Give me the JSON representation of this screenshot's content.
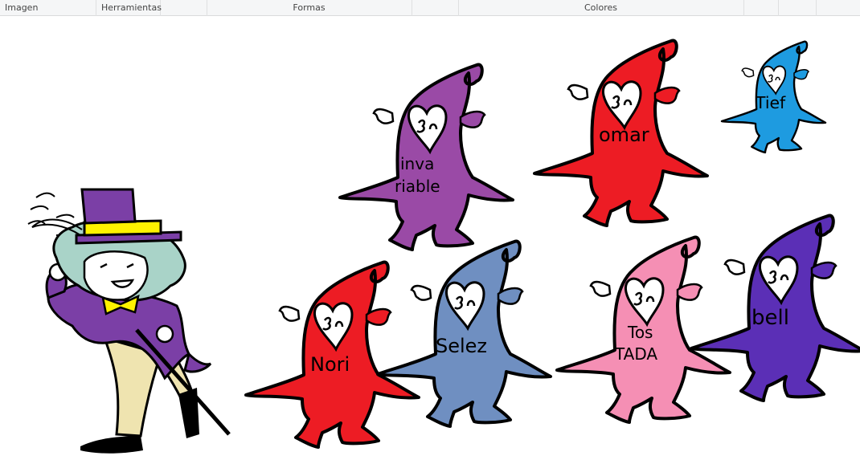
{
  "ribbon": {
    "group_image": "Imagen",
    "group_tools": "Herramientas",
    "group_shapes": "Formas",
    "group_colors": "Colores"
  },
  "canvas": {
    "characters": [
      {
        "id": "purple",
        "label_line1": "inva",
        "label_line2": "riable",
        "color": "#9a4aa6"
      },
      {
        "id": "omar",
        "label_line1": "omar",
        "label_line2": "",
        "color": "#ed1c24"
      },
      {
        "id": "tief",
        "label_line1": "Tief",
        "label_line2": "",
        "color": "#1e9be0"
      },
      {
        "id": "nori",
        "label_line1": "Nori",
        "label_line2": "",
        "color": "#ed1c24"
      },
      {
        "id": "selez",
        "label_line1": "Selez",
        "label_line2": "",
        "color": "#6f8fc1"
      },
      {
        "id": "tostada",
        "label_line1": "Tos",
        "label_line2": "TADA",
        "color": "#f58fb4"
      },
      {
        "id": "bell",
        "label_line1": "bell",
        "label_line2": "",
        "color": "#5b2fb6"
      }
    ],
    "hatter_colors": {
      "hat": "#7b3fa6",
      "band": "#fff200",
      "hair": "#a9d3c8",
      "coat": "#7b3fa6",
      "pants": "#efe4b0",
      "bowtie": "#fff200"
    }
  }
}
